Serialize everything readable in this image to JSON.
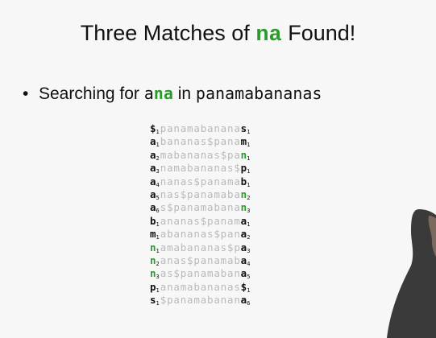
{
  "title": {
    "before": "Three Matches of ",
    "highlight": "na",
    "after": " Found!"
  },
  "bullet": {
    "symbol": "•",
    "text": "Searching for ",
    "pattern_first": "a",
    "pattern_rest": "na",
    "connector": " in ",
    "target": "panamabananas"
  },
  "matrix": [
    {
      "first": "$",
      "first_sub": "1",
      "middle": "panamabanana",
      "last": "s",
      "last_sub": "1",
      "first_green": false,
      "last_green": false
    },
    {
      "first": "a",
      "first_sub": "1",
      "middle": "bananas$pana",
      "last": "m",
      "last_sub": "1",
      "first_green": false,
      "last_green": false
    },
    {
      "first": "a",
      "first_sub": "2",
      "middle": "mabananas$pa",
      "last": "n",
      "last_sub": "1",
      "first_green": false,
      "last_green": true
    },
    {
      "first": "a",
      "first_sub": "3",
      "middle": "namabananas$",
      "last": "p",
      "last_sub": "1",
      "first_green": false,
      "last_green": false
    },
    {
      "first": "a",
      "first_sub": "4",
      "middle": "nanas$panama",
      "last": "b",
      "last_sub": "1",
      "first_green": false,
      "last_green": false
    },
    {
      "first": "a",
      "first_sub": "5",
      "middle": "nas$panamaba",
      "last": "n",
      "last_sub": "2",
      "first_green": false,
      "last_green": true
    },
    {
      "first": "a",
      "first_sub": "6",
      "middle": "s$panamabana",
      "last": "n",
      "last_sub": "3",
      "first_green": false,
      "last_green": true
    },
    {
      "first": "b",
      "first_sub": "1",
      "middle": "ananas$panam",
      "last": "a",
      "last_sub": "1",
      "first_green": false,
      "last_green": false
    },
    {
      "first": "m",
      "first_sub": "1",
      "middle": "abananas$pan",
      "last": "a",
      "last_sub": "2",
      "first_green": false,
      "last_green": false
    },
    {
      "first": "n",
      "first_sub": "1",
      "middle": "amabananas$p",
      "last": "a",
      "last_sub": "3",
      "first_green": true,
      "last_green": false
    },
    {
      "first": "n",
      "first_sub": "2",
      "middle": "anas$panamab",
      "last": "a",
      "last_sub": "4",
      "first_green": true,
      "last_green": false
    },
    {
      "first": "n",
      "first_sub": "3",
      "middle": "as$panamaban",
      "last": "a",
      "last_sub": "5",
      "first_green": true,
      "last_green": false
    },
    {
      "first": "p",
      "first_sub": "1",
      "middle": "anamabananas",
      "last": "$",
      "last_sub": "1",
      "first_green": false,
      "last_green": false
    },
    {
      "first": "s",
      "first_sub": "1",
      "middle": "$panamabanan",
      "last": "a",
      "last_sub": "6",
      "first_green": false,
      "last_green": false
    }
  ],
  "colors": {
    "highlight": "#2e9a2e",
    "muted": "#b9b9b9",
    "text": "#111111",
    "background": "#f7f7f7"
  }
}
